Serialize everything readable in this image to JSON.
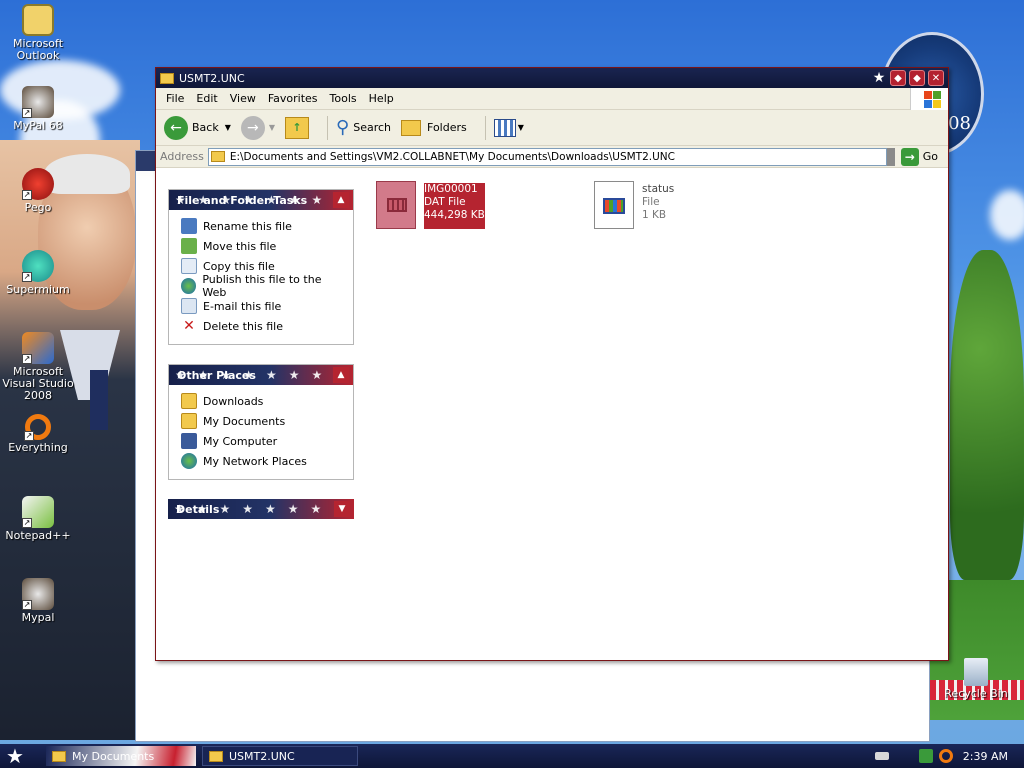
{
  "desktop": {
    "icons": [
      {
        "label": "Microsoft Outlook",
        "icon": "outlook-icon"
      },
      {
        "label": "MyPal 68",
        "icon": "mypal-icon"
      },
      {
        "label": "Pego",
        "icon": "pego-icon"
      },
      {
        "label": "Supermium",
        "icon": "supermium-icon"
      },
      {
        "label": "Microsoft Visual Studio 2008",
        "icon": "visual-studio-icon"
      },
      {
        "label": "Everything",
        "icon": "everything-icon"
      },
      {
        "label": "Notepad++",
        "icon": "notepadpp-icon"
      },
      {
        "label": "Mypal",
        "icon": "mypal-icon"
      }
    ],
    "recycle_bin": "Recycle Bin",
    "seal_text": "'08"
  },
  "window": {
    "title": "USMT2.UNC",
    "menu": [
      "File",
      "Edit",
      "View",
      "Favorites",
      "Tools",
      "Help"
    ],
    "toolbar": {
      "back": "Back",
      "search": "Search",
      "folders": "Folders"
    },
    "address": {
      "label": "Address",
      "value": "E:\\Documents and Settings\\VM2.COLLABNET\\My Documents\\Downloads\\USMT2.UNC",
      "go": "Go"
    }
  },
  "panels": {
    "file_tasks": {
      "title": "File and Folder Tasks",
      "items": [
        "Rename this file",
        "Move this file",
        "Copy this file",
        "Publish this file to the Web",
        "E-mail this file",
        "Delete this file"
      ]
    },
    "other_places": {
      "title": "Other Places",
      "items": [
        "Downloads",
        "My Documents",
        "My Computer",
        "My Network Places"
      ]
    },
    "details": {
      "title": "Details"
    }
  },
  "files": [
    {
      "name": "IMG00001",
      "type": "DAT File",
      "size": "444,298 KB",
      "selected": true
    },
    {
      "name": "status",
      "type": "File",
      "size": "1 KB",
      "selected": false
    }
  ],
  "taskbar": {
    "items": [
      "My Documents",
      "USMT2.UNC"
    ],
    "clock": "2:39 AM"
  },
  "colors": {
    "accent_red": "#b52430",
    "navy": "#16204a"
  }
}
